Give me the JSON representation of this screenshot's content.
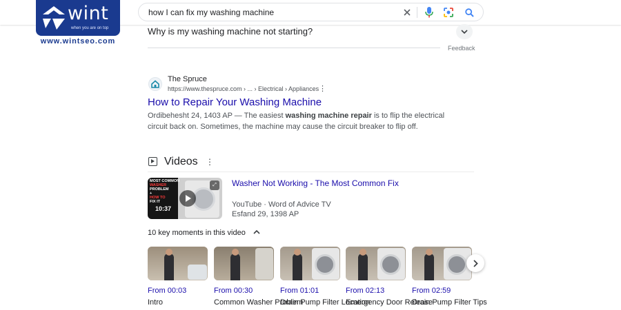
{
  "brand": {
    "logo_text": "wint",
    "tagline": "when you are on top",
    "site_url": "www.wintseo.com",
    "color": "#1a3a8f"
  },
  "search": {
    "query": "how I can fix my washing machine",
    "icons": [
      "close-icon",
      "mic-icon",
      "lens-icon",
      "search-icon"
    ]
  },
  "paa": {
    "question": "Why is my washing machine not starting?",
    "feedback": "Feedback"
  },
  "result": {
    "site_name": "The Spruce",
    "url": "https://www.thespruce.com › ... › Electrical › Appliances",
    "title": "How to Repair Your Washing Machine",
    "date": "Ordibehesht 24, 1403 AP",
    "snippet_prefix": " — The easiest ",
    "snippet_bold": "washing machine repair",
    "snippet_suffix": " is to flip the electrical circuit back on. Sometimes, the machine may cause the circuit breaker to flip off.",
    "link_color": "#1a0dab"
  },
  "videos": {
    "heading": "Videos",
    "main": {
      "title": "Washer Not Working - The Most Common Fix",
      "source": "YouTube · Word of Advice TV",
      "date": "Esfand 29, 1398 AP",
      "duration": "10:37",
      "thumb_lines": [
        "MOST COMMON",
        "WASHER",
        "PROBLEM",
        "+",
        "HOW TO",
        "FIX IT"
      ]
    },
    "key_moments_label": "10 key moments in this video",
    "moments": [
      {
        "time": "From 00:03",
        "caption": "Intro"
      },
      {
        "time": "From 00:30",
        "caption": "Common Washer Problem"
      },
      {
        "time": "From 01:01",
        "caption": "Drain Pump Filter Location"
      },
      {
        "time": "From 02:13",
        "caption": "Emergency Door Release"
      },
      {
        "time": "From 02:59",
        "caption": "Drain Pump Filter Tips"
      }
    ]
  }
}
